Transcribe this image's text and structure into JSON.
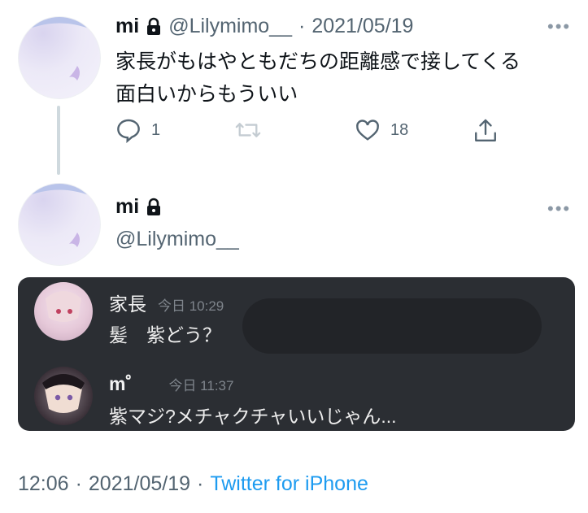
{
  "tweet1": {
    "name": "mi",
    "handle": "@Lilymimo__",
    "sep": "·",
    "date": "2021/05/19",
    "text_line1": "家長がもはやともだちの距離感で接してくる",
    "text_line2": "面白いからもういい",
    "more": "•••",
    "reply_count": "1",
    "like_count": "18",
    "icons": [
      "lock-icon",
      "reply-icon",
      "retweet-icon",
      "like-icon",
      "share-icon"
    ]
  },
  "tweet2": {
    "name": "mi",
    "handle": "@Lilymimo__",
    "more": "•••"
  },
  "chat": {
    "messages": [
      {
        "name": "家長",
        "time": "今日 10:29",
        "text": "髪　紫どう？"
      },
      {
        "name": "m゜",
        "time": "今日 11:37",
        "text": "紫マジ?メチャクチャいいじゃん..."
      }
    ],
    "colors": {
      "background": "#2b2e33",
      "redaction": "#222428"
    }
  },
  "footer": {
    "time": "12:06",
    "sep1": "·",
    "date": "2021/05/19",
    "sep2": "·",
    "source": "Twitter for iPhone"
  },
  "colors": {
    "accent": "#1d9bf0",
    "secondary_text": "#536471",
    "primary_text": "#0f1419"
  }
}
